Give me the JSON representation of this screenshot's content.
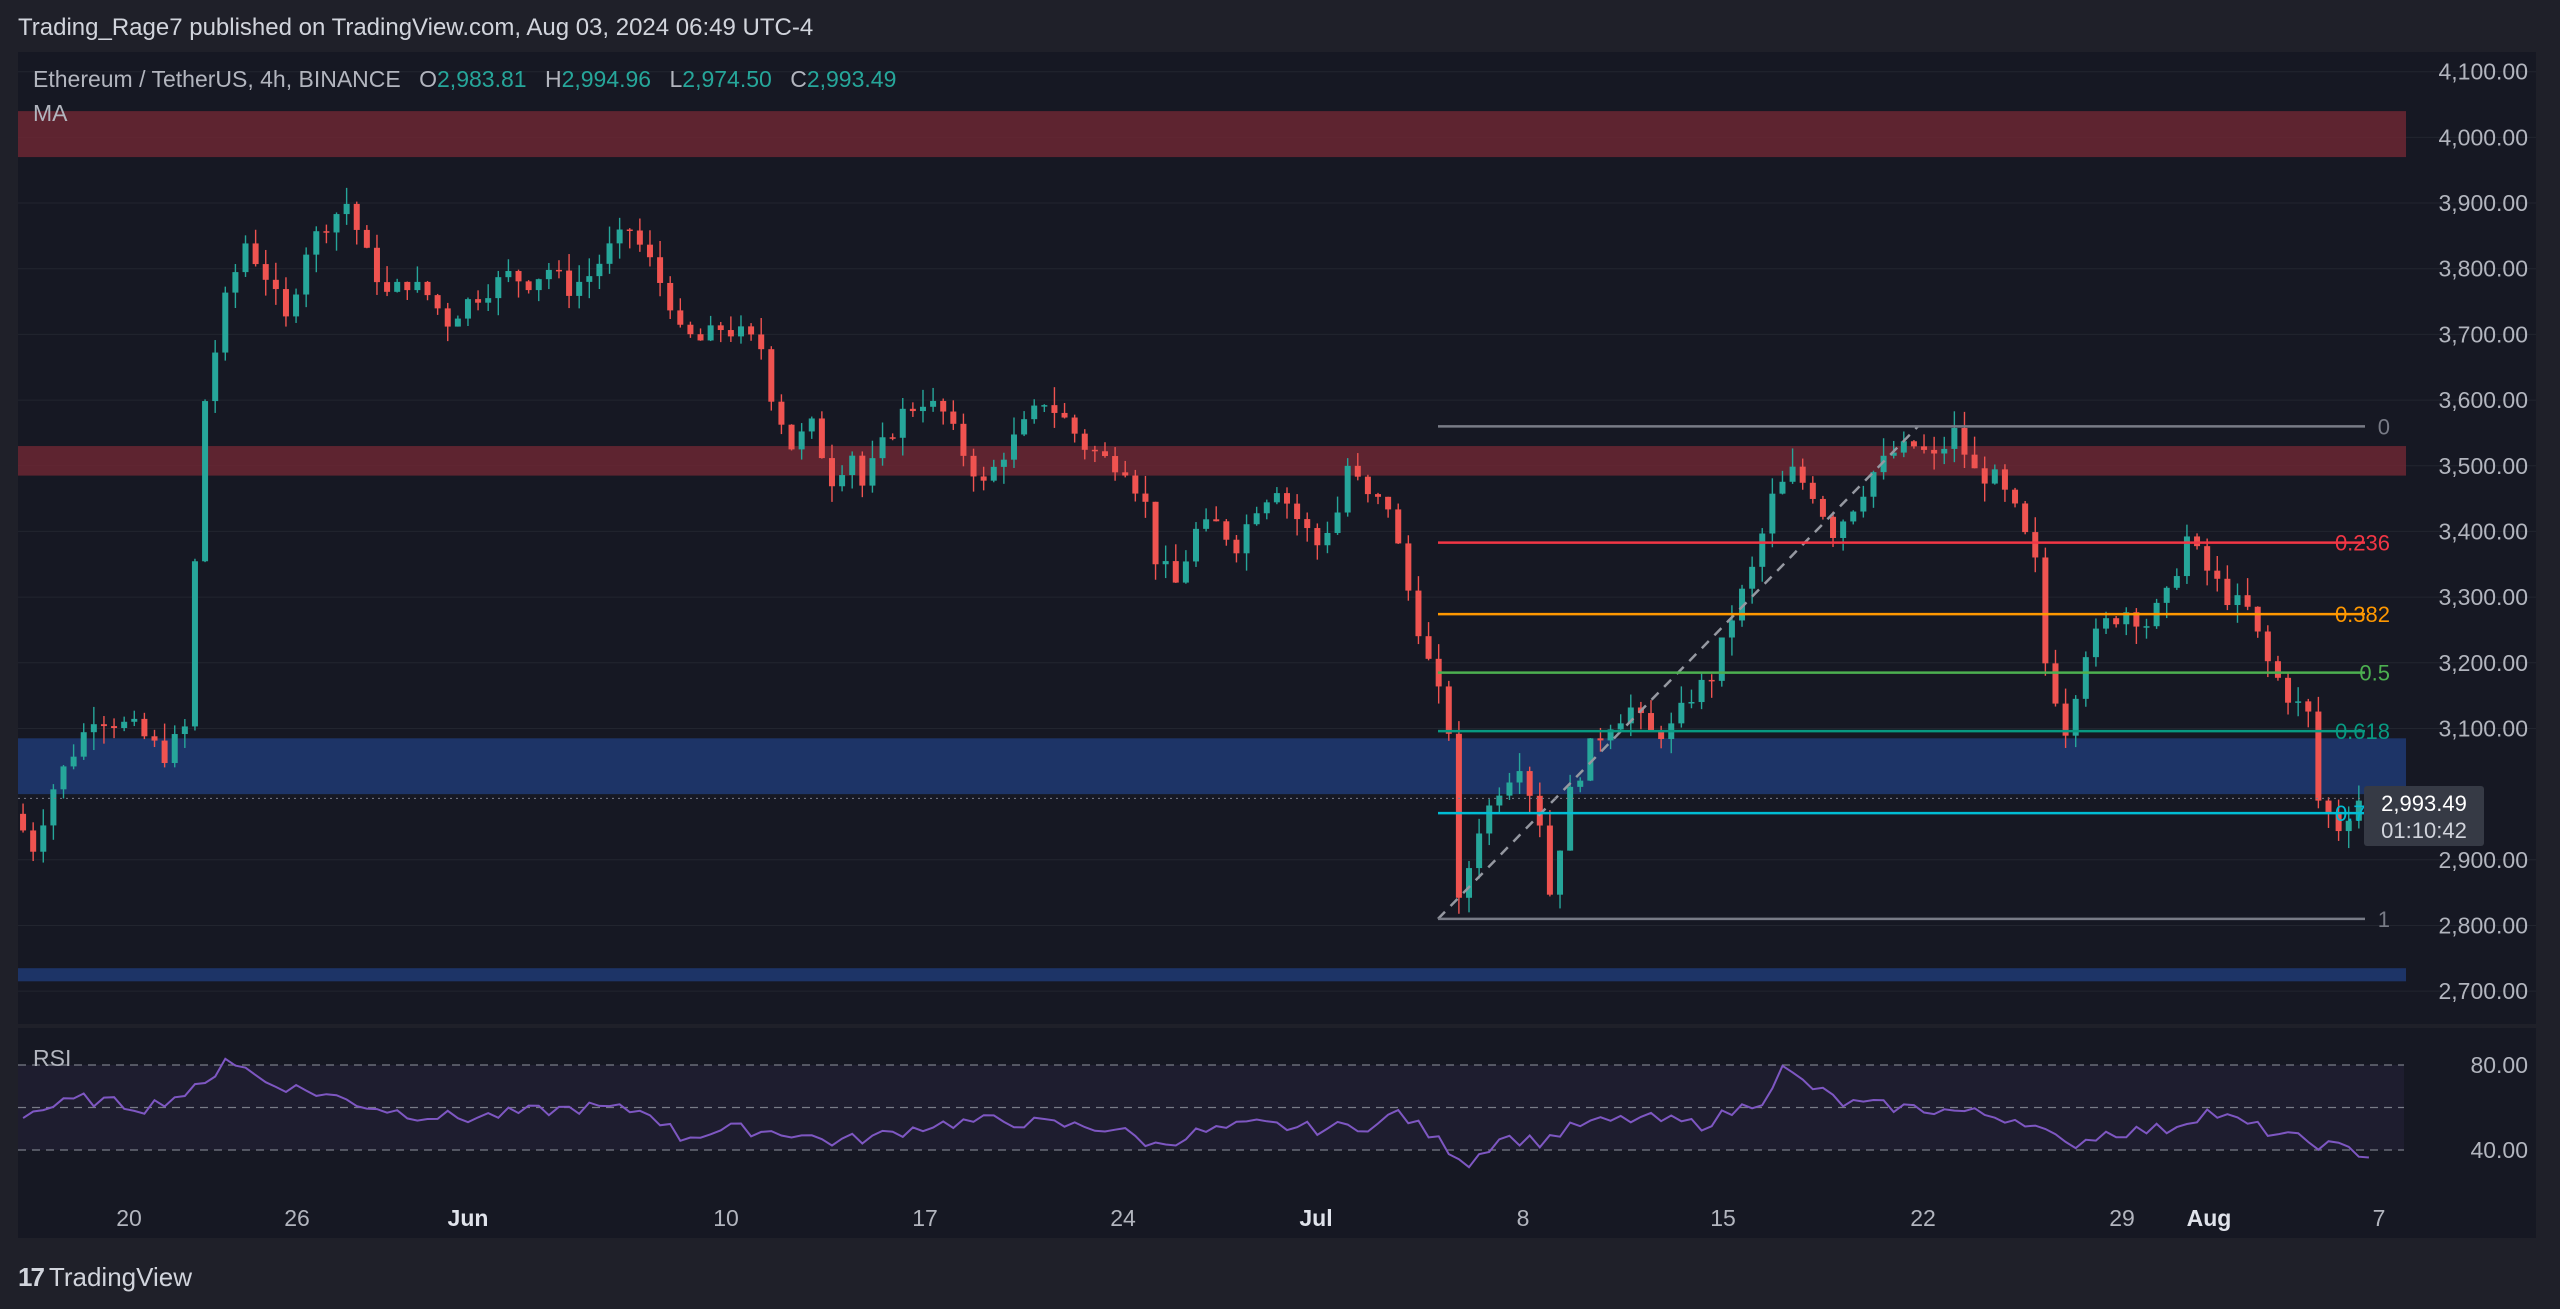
{
  "header": {
    "publisher_line": "Trading_Rage7 published on TradingView.com, Aug 03, 2024 06:49 UTC-4"
  },
  "legend": {
    "symbol": "Ethereum / TetherUS, 4h, BINANCE",
    "o_label": "O",
    "o_value": "2,983.81",
    "h_label": "H",
    "h_value": "2,994.96",
    "l_label": "L",
    "l_value": "2,974.50",
    "c_label": "C",
    "c_value": "2,993.49",
    "ma_label": "MA"
  },
  "rsi": {
    "label": "RSI",
    "upper_tick": "80.00",
    "lower_tick": "40.00"
  },
  "footer": {
    "brand": "TradingView",
    "logo_glyph": "17"
  },
  "price_badge": {
    "price": "2,993.49",
    "countdown": "01:10:42"
  },
  "colors": {
    "background": "#1f2029",
    "up": "#26a69a",
    "down": "#ef5350",
    "resistance_zone": "#6b2732",
    "support_zone": "#1f3a73",
    "rsi_line": "#7e57c2"
  },
  "chart_data": {
    "type": "candlestick",
    "title": "Ethereum / TetherUS, 4h, BINANCE",
    "y_ticks": [
      "4,100.00",
      "4,000.00",
      "3,900.00",
      "3,800.00",
      "3,700.00",
      "3,600.00",
      "3,500.00",
      "3,400.00",
      "3,300.00",
      "3,200.00",
      "3,100.00",
      "2,900.00",
      "2,800.00",
      "2,700.00"
    ],
    "x_ticks": [
      "20",
      "26",
      "Jun",
      "10",
      "17",
      "24",
      "Jul",
      "8",
      "15",
      "22",
      "29",
      "Aug",
      "7"
    ],
    "ylim": [
      2650,
      4130
    ],
    "price_path": [
      [
        0,
        2970
      ],
      [
        2,
        2920
      ],
      [
        4,
        3010
      ],
      [
        8,
        3120
      ],
      [
        12,
        3100
      ],
      [
        15,
        3060
      ],
      [
        17,
        3100
      ],
      [
        19,
        3600
      ],
      [
        21,
        3750
      ],
      [
        23,
        3840
      ],
      [
        25,
        3790
      ],
      [
        27,
        3720
      ],
      [
        29,
        3830
      ],
      [
        31,
        3870
      ],
      [
        33,
        3900
      ],
      [
        35,
        3820
      ],
      [
        37,
        3760
      ],
      [
        39,
        3780
      ],
      [
        41,
        3760
      ],
      [
        43,
        3720
      ],
      [
        45,
        3750
      ],
      [
        47,
        3770
      ],
      [
        49,
        3790
      ],
      [
        51,
        3780
      ],
      [
        53,
        3800
      ],
      [
        55,
        3770
      ],
      [
        57,
        3790
      ],
      [
        59,
        3830
      ],
      [
        61,
        3860
      ],
      [
        63,
        3810
      ],
      [
        65,
        3750
      ],
      [
        66,
        3700
      ],
      [
        68,
        3690
      ],
      [
        70,
        3710
      ],
      [
        72,
        3700
      ],
      [
        74,
        3680
      ],
      [
        75,
        3610
      ],
      [
        77,
        3530
      ],
      [
        79,
        3560
      ],
      [
        81,
        3480
      ],
      [
        83,
        3520
      ],
      [
        84,
        3470
      ],
      [
        86,
        3530
      ],
      [
        88,
        3580
      ],
      [
        90,
        3600
      ],
      [
        92,
        3580
      ],
      [
        94,
        3520
      ],
      [
        96,
        3470
      ],
      [
        98,
        3520
      ],
      [
        100,
        3560
      ],
      [
        102,
        3600
      ],
      [
        104,
        3570
      ],
      [
        106,
        3530
      ],
      [
        108,
        3510
      ],
      [
        110,
        3500
      ],
      [
        112,
        3440
      ],
      [
        113,
        3360
      ],
      [
        115,
        3320
      ],
      [
        117,
        3400
      ],
      [
        119,
        3410
      ],
      [
        121,
        3380
      ],
      [
        123,
        3440
      ],
      [
        125,
        3470
      ],
      [
        127,
        3420
      ],
      [
        129,
        3380
      ],
      [
        131,
        3430
      ],
      [
        132,
        3500
      ],
      [
        134,
        3450
      ],
      [
        136,
        3440
      ],
      [
        138,
        3310
      ],
      [
        140,
        3200
      ],
      [
        142,
        3100
      ],
      [
        143,
        2830
      ],
      [
        145,
        2950
      ],
      [
        147,
        3010
      ],
      [
        149,
        3050
      ],
      [
        151,
        2960
      ],
      [
        152,
        2850
      ],
      [
        154,
        3000
      ],
      [
        156,
        3070
      ],
      [
        158,
        3110
      ],
      [
        160,
        3130
      ],
      [
        162,
        3090
      ],
      [
        164,
        3100
      ],
      [
        166,
        3150
      ],
      [
        168,
        3180
      ],
      [
        170,
        3270
      ],
      [
        172,
        3340
      ],
      [
        174,
        3450
      ],
      [
        176,
        3490
      ],
      [
        178,
        3460
      ],
      [
        180,
        3400
      ],
      [
        182,
        3440
      ],
      [
        184,
        3490
      ],
      [
        186,
        3520
      ],
      [
        188,
        3530
      ],
      [
        190,
        3510
      ],
      [
        192,
        3550
      ],
      [
        194,
        3490
      ],
      [
        196,
        3480
      ],
      [
        198,
        3430
      ],
      [
        200,
        3350
      ],
      [
        201,
        3200
      ],
      [
        203,
        3100
      ],
      [
        205,
        3220
      ],
      [
        207,
        3260
      ],
      [
        209,
        3280
      ],
      [
        211,
        3260
      ],
      [
        213,
        3300
      ],
      [
        215,
        3390
      ],
      [
        217,
        3340
      ],
      [
        219,
        3300
      ],
      [
        221,
        3280
      ],
      [
        223,
        3200
      ],
      [
        225,
        3150
      ],
      [
        227,
        3120
      ],
      [
        228,
        2990
      ],
      [
        230,
        2950
      ],
      [
        232,
        2993
      ]
    ],
    "rsi_series": [
      [
        0,
        57
      ],
      [
        6,
        64
      ],
      [
        12,
        60
      ],
      [
        18,
        70
      ],
      [
        20,
        84
      ],
      [
        24,
        72
      ],
      [
        30,
        66
      ],
      [
        34,
        61
      ],
      [
        38,
        57
      ],
      [
        44,
        55
      ],
      [
        50,
        58
      ],
      [
        56,
        60
      ],
      [
        62,
        58
      ],
      [
        65,
        46
      ],
      [
        70,
        50
      ],
      [
        76,
        48
      ],
      [
        80,
        44
      ],
      [
        84,
        46
      ],
      [
        90,
        52
      ],
      [
        96,
        54
      ],
      [
        102,
        52
      ],
      [
        108,
        50
      ],
      [
        112,
        42
      ],
      [
        116,
        48
      ],
      [
        122,
        52
      ],
      [
        128,
        50
      ],
      [
        134,
        52
      ],
      [
        136,
        58
      ],
      [
        140,
        44
      ],
      [
        143,
        34
      ],
      [
        146,
        46
      ],
      [
        150,
        44
      ],
      [
        154,
        52
      ],
      [
        160,
        55
      ],
      [
        166,
        52
      ],
      [
        172,
        64
      ],
      [
        174,
        78
      ],
      [
        176,
        72
      ],
      [
        180,
        62
      ],
      [
        186,
        60
      ],
      [
        192,
        58
      ],
      [
        198,
        54
      ],
      [
        202,
        42
      ],
      [
        206,
        48
      ],
      [
        212,
        50
      ],
      [
        216,
        58
      ],
      [
        220,
        52
      ],
      [
        224,
        46
      ],
      [
        228,
        42
      ],
      [
        232,
        38
      ]
    ],
    "rsi_levels": [
      80,
      40
    ],
    "zones": [
      {
        "label": "resistance",
        "from": 3970,
        "to": 4040
      },
      {
        "label": "resistance",
        "from": 3485,
        "to": 3530
      },
      {
        "label": "support",
        "from": 3000,
        "to": 3085
      },
      {
        "label": "support",
        "from": 2715,
        "to": 2735
      }
    ],
    "fibonacci": {
      "high": 3560,
      "low": 2810,
      "levels": [
        {
          "ratio": "0",
          "price": 3560,
          "color": "#787b86"
        },
        {
          "ratio": "0.236",
          "price": 3383,
          "color": "#f23645"
        },
        {
          "ratio": "0.382",
          "price": 3274,
          "color": "#ff9800"
        },
        {
          "ratio": "0.5",
          "price": 3185,
          "color": "#4caf50"
        },
        {
          "ratio": "0.618",
          "price": 3096,
          "color": "#089981"
        },
        {
          "ratio": "0.786",
          "price": 2971,
          "color": "#00bcd4"
        },
        {
          "ratio": "1",
          "price": 2810,
          "color": "#787b86"
        }
      ]
    },
    "last_price": 2993.49
  }
}
